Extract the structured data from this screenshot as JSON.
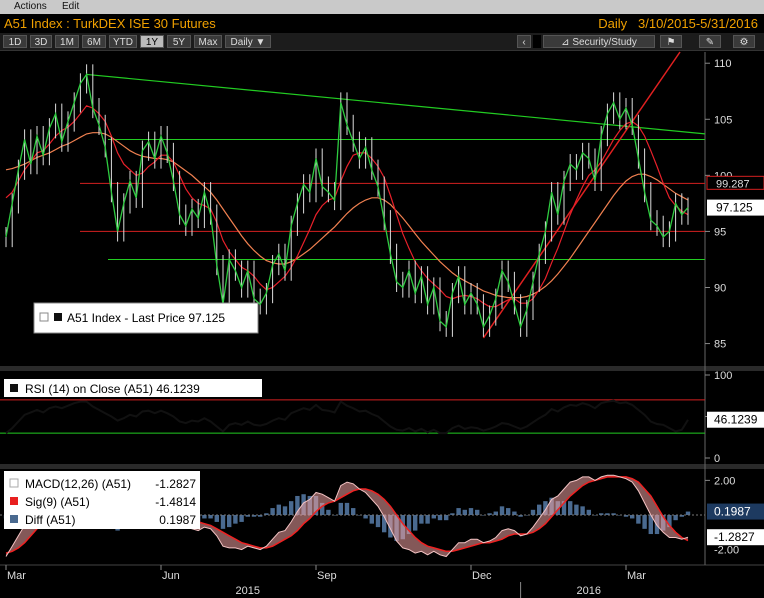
{
  "menu": {
    "actions": "Actions",
    "edit": "Edit"
  },
  "title": {
    "left": "A51 Index : TurkDEX ISE 30 Futures",
    "frequency": "Daily",
    "range": "3/10/2015-5/31/2016"
  },
  "toolbar": {
    "periods": [
      "1D",
      "3D",
      "1M",
      "6M",
      "YTD",
      "1Y",
      "5Y",
      "Max"
    ],
    "active_period": "1Y",
    "interval": "Daily ▼",
    "security_study": "Security/Study"
  },
  "colors": {
    "price": "#2ecc40",
    "ma_fast": "#e8202a",
    "ma_slow": "#f08050",
    "trend_green": "#22cc22",
    "support_red": "#d42020",
    "macd_white": "#ffffff",
    "sig_red": "#ee2222",
    "diff_blue": "#4a6a90"
  },
  "chart_data": [
    {
      "type": "line",
      "name": "price-panel",
      "legend": "A51 Index - Last Price 97.125",
      "ylim": [
        83,
        111
      ],
      "yticks": [
        85,
        90,
        95,
        100,
        105,
        110
      ],
      "last_value_label": "97.125",
      "marker_label": "99.287",
      "x_month_labels": [
        "Mar",
        "Jun",
        "Sep",
        "Dec",
        "Mar"
      ],
      "x_year_labels": [
        "2015",
        "2016"
      ],
      "series": [
        {
          "name": "A51 Index - Last Price",
          "values": [
            94.5,
            97.5,
            100.5,
            103.2,
            101.0,
            103.5,
            101.8,
            104.2,
            105.5,
            103.0,
            104.8,
            106.5,
            108.2,
            109.0,
            106.0,
            104.5,
            102.5,
            98.5,
            95.0,
            97.5,
            99.5,
            98.0,
            102.2,
            103.0,
            101.5,
            103.5,
            102.0,
            99.5,
            96.5,
            95.5,
            97.0,
            96.2,
            98.5,
            96.5,
            92.0,
            88.5,
            92.5,
            91.5,
            90.0,
            91.5,
            89.0,
            88.5,
            89.5,
            92.0,
            93.0,
            91.5,
            95.5,
            97.5,
            99.2,
            98.5,
            101.5,
            99.0,
            98.5,
            97.8,
            106.5,
            104.5,
            103.0,
            101.5,
            102.5,
            100.5,
            99.0,
            96.0,
            93.0,
            90.5,
            90.0,
            91.5,
            89.5,
            91.0,
            88.5,
            90.0,
            87.0,
            86.5,
            89.5,
            91.0,
            88.5,
            89.5,
            88.5,
            86.5,
            87.5,
            89.0,
            91.5,
            90.5,
            88.5,
            86.5,
            88.0,
            90.5,
            93.0,
            95.0,
            98.5,
            96.5,
            99.5,
            101.0,
            100.5,
            102.0,
            101.5,
            99.5,
            103.5,
            105.5,
            106.5,
            105.0,
            106.0,
            104.5,
            101.5,
            98.5,
            96.0,
            95.5,
            94.5,
            95.0,
            97.5,
            96.5,
            97.125
          ]
        },
        {
          "name": "MA fast",
          "values": [
            98.0,
            98.5,
            99.5,
            100.5,
            101.2,
            102.0,
            102.2,
            102.8,
            103.5,
            104.0,
            104.3,
            104.8,
            105.5,
            106.2,
            106.0,
            105.5,
            104.8,
            103.5,
            102.0,
            101.0,
            100.5,
            100.0,
            100.2,
            100.8,
            101.2,
            101.8,
            101.8,
            101.2,
            100.0,
            98.8,
            98.0,
            97.5,
            97.3,
            97.0,
            95.8,
            94.2,
            93.2,
            92.5,
            91.8,
            91.5,
            91.0,
            90.3,
            89.8,
            90.0,
            90.5,
            91.0,
            91.8,
            92.8,
            94.0,
            95.2,
            96.5,
            97.3,
            97.8,
            98.0,
            99.5,
            100.8,
            101.8,
            102.0,
            102.0,
            101.5,
            100.8,
            99.8,
            98.2,
            96.5,
            94.8,
            93.5,
            92.3,
            91.5,
            90.8,
            90.3,
            89.8,
            89.2,
            89.0,
            89.2,
            89.3,
            89.2,
            89.0,
            88.6,
            88.3,
            88.3,
            88.6,
            88.9,
            89.0,
            88.6,
            88.6,
            89.0,
            89.8,
            90.8,
            92.2,
            93.5,
            95.0,
            96.5,
            97.8,
            99.0,
            100.0,
            100.5,
            101.2,
            102.2,
            103.2,
            104.0,
            104.6,
            104.8,
            104.4,
            103.5,
            102.2,
            100.8,
            99.3,
            98.0,
            97.3,
            96.8,
            96.5
          ]
        },
        {
          "name": "MA slow",
          "values": [
            100.5,
            100.6,
            100.8,
            101.0,
            101.3,
            101.6,
            101.8,
            102.0,
            102.3,
            102.6,
            102.8,
            103.1,
            103.4,
            103.7,
            103.8,
            103.8,
            103.7,
            103.4,
            103.0,
            102.6,
            102.2,
            101.9,
            101.7,
            101.6,
            101.5,
            101.5,
            101.4,
            101.2,
            100.8,
            100.4,
            100.0,
            99.5,
            99.0,
            98.5,
            97.8,
            97.0,
            96.2,
            95.4,
            94.6,
            93.9,
            93.3,
            92.8,
            92.4,
            92.2,
            92.1,
            92.1,
            92.3,
            92.6,
            93.0,
            93.4,
            93.9,
            94.4,
            94.9,
            95.4,
            96.0,
            96.6,
            97.1,
            97.5,
            97.8,
            98.0,
            98.0,
            97.8,
            97.4,
            96.8,
            96.2,
            95.5,
            94.8,
            94.1,
            93.5,
            92.9,
            92.3,
            91.8,
            91.3,
            90.9,
            90.6,
            90.3,
            90.0,
            89.7,
            89.5,
            89.3,
            89.2,
            89.1,
            89.1,
            89.1,
            89.2,
            89.4,
            89.7,
            90.1,
            90.6,
            91.2,
            91.9,
            92.6,
            93.4,
            94.2,
            95.0,
            95.8,
            96.6,
            97.4,
            98.2,
            98.9,
            99.5,
            99.9,
            100.1,
            100.1,
            99.9,
            99.6,
            99.2,
            98.8,
            98.4,
            98.1,
            97.8
          ]
        }
      ]
    },
    {
      "type": "line",
      "name": "rsi-panel",
      "legend": "RSI (14) on Close (A51) 46.1239",
      "ylim": [
        0,
        100
      ],
      "yticks": [
        0,
        50,
        100
      ],
      "levels": [
        70,
        30
      ],
      "last_value_label": "46.1239",
      "series": [
        {
          "name": "RSI (14) on Close (A51)",
          "values": [
            30,
            36,
            44,
            52,
            55,
            58,
            55,
            60,
            62,
            60,
            63,
            66,
            68,
            68,
            62,
            58,
            54,
            50,
            45,
            48,
            52,
            50,
            56,
            57,
            54,
            57,
            54,
            50,
            44,
            42,
            45,
            44,
            48,
            44,
            38,
            32,
            40,
            42,
            40,
            44,
            40,
            39,
            41,
            45,
            48,
            46,
            54,
            57,
            60,
            58,
            64,
            58,
            57,
            55,
            68,
            63,
            60,
            56,
            57,
            53,
            50,
            44,
            38,
            34,
            33,
            36,
            32,
            35,
            31,
            34,
            30,
            30,
            36,
            39,
            35,
            37,
            36,
            33,
            35,
            38,
            42,
            41,
            38,
            35,
            38,
            43,
            48,
            52,
            59,
            56,
            61,
            64,
            63,
            66,
            64,
            60,
            66,
            68,
            69,
            66,
            67,
            64,
            58,
            52,
            44,
            41,
            40,
            36,
            32,
            34,
            46
          ]
        }
      ]
    },
    {
      "type": "line",
      "name": "macd-panel",
      "ylim": [
        -2.6,
        2.6
      ],
      "yticks": [
        -2.0,
        2.0
      ],
      "ytick_labels": [
        "-2.00",
        "2.00"
      ],
      "last_value_labels": [
        "0.1987",
        "-1.2827"
      ],
      "legend": [
        {
          "label": "MACD(12,26) (A51)",
          "value": "-1.2827"
        },
        {
          "label": "Sig(9) (A51)",
          "value": "-1.4814"
        },
        {
          "label": "Diff (A51)",
          "value": "0.1987"
        }
      ],
      "series": [
        {
          "name": "MACD(12,26) (A51)",
          "values": [
            -2.4,
            -1.8,
            -1.2,
            -0.6,
            -0.1,
            0.3,
            0.5,
            0.8,
            1.0,
            1.1,
            1.3,
            1.6,
            1.9,
            2.1,
            1.9,
            1.6,
            1.2,
            0.7,
            0.1,
            -0.2,
            -0.3,
            -0.3,
            0.0,
            0.3,
            0.4,
            0.6,
            0.5,
            0.2,
            -0.3,
            -0.7,
            -0.8,
            -0.9,
            -0.7,
            -0.8,
            -1.2,
            -1.8,
            -1.9,
            -1.9,
            -2.0,
            -1.8,
            -1.9,
            -2.0,
            -1.8,
            -1.4,
            -1.0,
            -0.9,
            -0.4,
            0.2,
            0.7,
            0.9,
            1.3,
            1.2,
            1.0,
            0.8,
            1.7,
            1.9,
            1.8,
            1.5,
            1.3,
            0.9,
            0.5,
            -0.1,
            -0.8,
            -1.5,
            -1.9,
            -2.0,
            -2.2,
            -2.1,
            -2.3,
            -2.1,
            -2.3,
            -2.4,
            -2.0,
            -1.6,
            -1.6,
            -1.4,
            -1.4,
            -1.6,
            -1.5,
            -1.3,
            -0.9,
            -0.8,
            -0.9,
            -1.2,
            -1.1,
            -0.7,
            -0.2,
            0.3,
            0.9,
            1.1,
            1.5,
            1.9,
            2.0,
            2.2,
            2.2,
            2.0,
            2.2,
            2.3,
            2.3,
            2.2,
            2.1,
            1.9,
            1.4,
            0.7,
            0.0,
            -0.6,
            -1.0,
            -1.3,
            -1.3,
            -1.4,
            -1.28
          ]
        },
        {
          "name": "Sig(9) (A51)",
          "values": [
            -2.2,
            -2.1,
            -1.9,
            -1.6,
            -1.2,
            -0.8,
            -0.4,
            0.0,
            0.3,
            0.6,
            0.8,
            1.0,
            1.3,
            1.5,
            1.7,
            1.7,
            1.6,
            1.4,
            1.0,
            0.6,
            0.3,
            0.1,
            0.0,
            0.0,
            0.1,
            0.2,
            0.3,
            0.3,
            0.2,
            0.0,
            -0.2,
            -0.4,
            -0.5,
            -0.6,
            -0.8,
            -1.0,
            -1.2,
            -1.4,
            -1.6,
            -1.7,
            -1.8,
            -1.9,
            -1.9,
            -1.8,
            -1.6,
            -1.4,
            -1.2,
            -0.9,
            -0.5,
            -0.2,
            0.2,
            0.5,
            0.7,
            0.8,
            1.0,
            1.2,
            1.4,
            1.5,
            1.5,
            1.4,
            1.2,
            0.9,
            0.5,
            0.0,
            -0.5,
            -0.9,
            -1.3,
            -1.6,
            -1.8,
            -1.9,
            -2.0,
            -2.1,
            -2.1,
            -2.0,
            -1.9,
            -1.8,
            -1.7,
            -1.6,
            -1.6,
            -1.5,
            -1.4,
            -1.2,
            -1.1,
            -1.1,
            -1.1,
            -1.0,
            -0.8,
            -0.5,
            -0.1,
            0.3,
            0.7,
            1.1,
            1.4,
            1.7,
            1.9,
            2.0,
            2.1,
            2.2,
            2.2,
            2.2,
            2.2,
            2.1,
            1.9,
            1.5,
            1.1,
            0.5,
            -0.1,
            -0.6,
            -1.0,
            -1.3,
            -1.48
          ]
        },
        {
          "name": "Diff (A51)",
          "values": [
            -0.2,
            0.3,
            0.7,
            1.0,
            1.1,
            1.1,
            0.9,
            0.8,
            0.7,
            0.5,
            0.5,
            0.6,
            0.6,
            0.6,
            0.2,
            -0.1,
            -0.4,
            -0.7,
            -0.9,
            -0.8,
            -0.6,
            -0.4,
            0.0,
            0.3,
            0.3,
            0.4,
            0.2,
            -0.1,
            -0.5,
            -0.7,
            -0.6,
            -0.5,
            -0.2,
            -0.2,
            -0.4,
            -0.8,
            -0.7,
            -0.5,
            -0.4,
            -0.1,
            -0.1,
            -0.1,
            0.1,
            0.4,
            0.6,
            0.5,
            0.8,
            1.1,
            1.2,
            1.1,
            1.1,
            0.7,
            0.3,
            0.0,
            0.7,
            0.7,
            0.4,
            0.0,
            -0.2,
            -0.5,
            -0.7,
            -1.0,
            -1.3,
            -1.5,
            -1.4,
            -1.1,
            -0.9,
            -0.5,
            -0.5,
            -0.2,
            -0.3,
            -0.3,
            0.1,
            0.4,
            0.3,
            0.4,
            0.3,
            0.0,
            0.1,
            0.2,
            0.5,
            0.4,
            0.2,
            -0.1,
            0.0,
            0.3,
            0.6,
            0.8,
            1.0,
            0.8,
            0.8,
            0.8,
            0.6,
            0.5,
            0.3,
            0.0,
            0.1,
            0.1,
            0.1,
            0.0,
            -0.1,
            -0.2,
            -0.5,
            -0.8,
            -1.1,
            -1.1,
            -0.9,
            -0.7,
            -0.3,
            -0.1,
            0.1987
          ]
        }
      ]
    }
  ]
}
